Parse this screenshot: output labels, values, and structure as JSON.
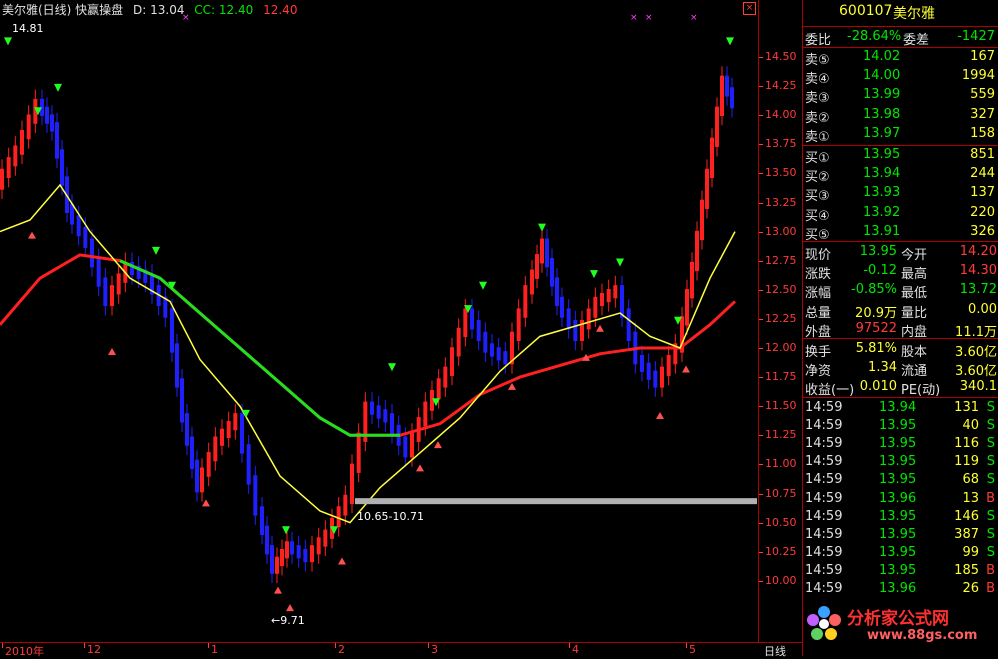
{
  "header": {
    "title": "美尔雅(日线) 快赢操盘",
    "d_label": "D: 13.04",
    "cc_label": "CC: 12.40",
    "last_label": "12.40"
  },
  "annotations": {
    "high": "14.81",
    "low": "←9.71",
    "zone": "10.65-10.71"
  },
  "price_axis": [
    "14.50",
    "14.25",
    "14.00",
    "13.75",
    "13.50",
    "13.25",
    "13.00",
    "12.75",
    "12.50",
    "12.25",
    "12.00",
    "11.75",
    "11.50",
    "11.25",
    "11.00",
    "10.75",
    "10.50",
    "10.25",
    "10.00"
  ],
  "time_axis": [
    "2010年",
    "12",
    "1",
    "2",
    "3",
    "4",
    "5"
  ],
  "period_button": "日线",
  "stock": {
    "code": "600107",
    "name": "美尔雅"
  },
  "weibi": {
    "label": "委比",
    "value": "-28.64%",
    "diff_label": "委差",
    "diff_value": "-1427"
  },
  "sell_orders": [
    {
      "label": "卖⑤",
      "price": "14.02",
      "vol": "167"
    },
    {
      "label": "卖④",
      "price": "14.00",
      "vol": "1994"
    },
    {
      "label": "卖③",
      "price": "13.99",
      "vol": "559"
    },
    {
      "label": "卖②",
      "price": "13.98",
      "vol": "327"
    },
    {
      "label": "卖①",
      "price": "13.97",
      "vol": "158"
    }
  ],
  "buy_orders": [
    {
      "label": "买①",
      "price": "13.95",
      "vol": "851"
    },
    {
      "label": "买②",
      "price": "13.94",
      "vol": "244"
    },
    {
      "label": "买③",
      "price": "13.93",
      "vol": "137"
    },
    {
      "label": "买④",
      "price": "13.92",
      "vol": "220"
    },
    {
      "label": "买⑤",
      "price": "13.91",
      "vol": "326"
    }
  ],
  "quote": [
    {
      "l1": "现价",
      "v1": "13.95",
      "l2": "今开",
      "v2": "14.20"
    },
    {
      "l1": "涨跌",
      "v1": "-0.12",
      "l2": "最高",
      "v2": "14.30"
    },
    {
      "l1": "涨幅",
      "v1": "-0.85%",
      "l2": "最低",
      "v2": "13.72"
    },
    {
      "l1": "总量",
      "v1": "20.9万",
      "l2": "量比",
      "v2": "0.00"
    },
    {
      "l1": "外盘",
      "v1": "97522",
      "l2": "内盘",
      "v2": "11.1万"
    }
  ],
  "stats": [
    {
      "l1": "换手",
      "v1": "5.81%",
      "l2": "股本",
      "v2": "3.60亿"
    },
    {
      "l1": "净资",
      "v1": "1.34",
      "l2": "流通",
      "v2": "3.60亿"
    },
    {
      "l1": "收益(一)",
      "v1": "0.010",
      "l2": "PE(动)",
      "v2": "340.1"
    }
  ],
  "ticks": [
    {
      "time": "14:59",
      "price": "13.94",
      "vol": "131",
      "side": "S"
    },
    {
      "time": "14:59",
      "price": "13.95",
      "vol": "40",
      "side": "S"
    },
    {
      "time": "14:59",
      "price": "13.95",
      "vol": "116",
      "side": "S"
    },
    {
      "time": "14:59",
      "price": "13.95",
      "vol": "119",
      "side": "S"
    },
    {
      "time": "14:59",
      "price": "13.95",
      "vol": "68",
      "side": "S"
    },
    {
      "time": "14:59",
      "price": "13.96",
      "vol": "13",
      "side": "B"
    },
    {
      "time": "14:59",
      "price": "13.95",
      "vol": "146",
      "side": "S"
    },
    {
      "time": "14:59",
      "price": "13.95",
      "vol": "387",
      "side": "S"
    },
    {
      "time": "14:59",
      "price": "13.95",
      "vol": "99",
      "side": "S"
    },
    {
      "time": "14:59",
      "price": "13.95",
      "vol": "185",
      "side": "B"
    },
    {
      "time": "14:59",
      "price": "13.96",
      "vol": "26",
      "side": "B"
    }
  ],
  "watermark": {
    "brand": "分析家公式网",
    "url": "www.88gs.com"
  },
  "colors": {
    "up": "#ff2020",
    "down": "#2020ff",
    "ma_short": "#ffff40",
    "ma_long_up": "#ff2020",
    "ma_long_flat": "#20e020",
    "buy_arrow": "#ff5050",
    "sell_arrow": "#20ff20"
  }
}
